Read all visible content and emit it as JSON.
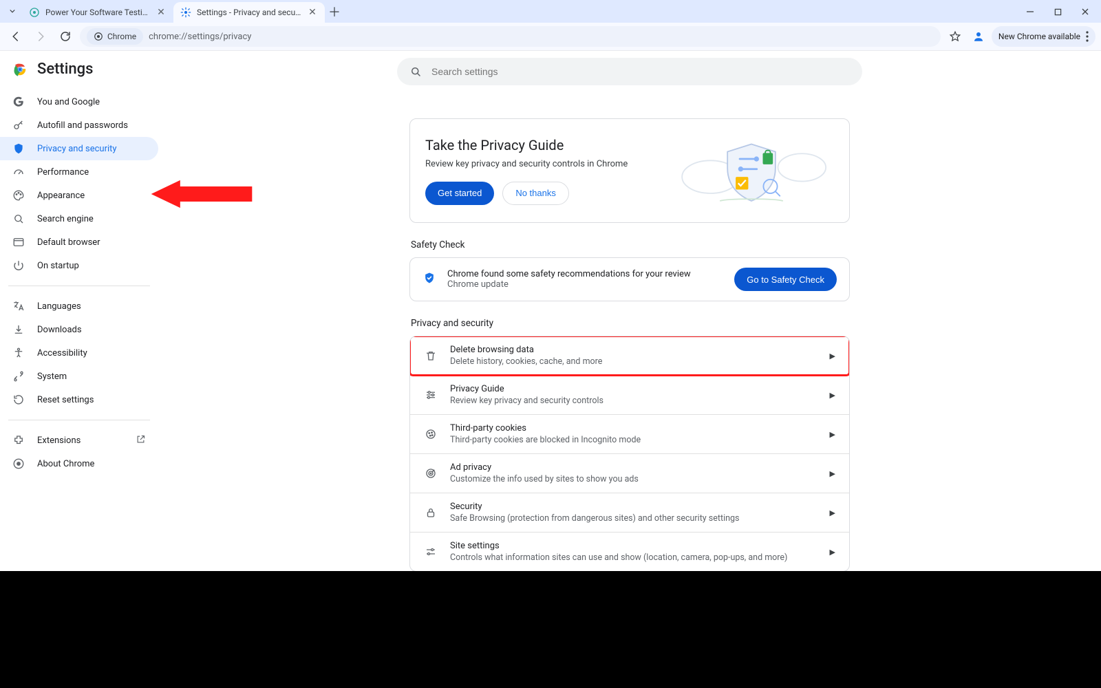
{
  "tabs": [
    {
      "title": "Power Your Software Testing wi",
      "favicon": "app"
    },
    {
      "title": "Settings - Privacy and security",
      "favicon": "gear",
      "active": true
    }
  ],
  "toolbar": {
    "chip_label": "Chrome",
    "url": "chrome://settings/privacy",
    "update_label": "New Chrome available"
  },
  "settings_title": "Settings",
  "search": {
    "placeholder": "Search settings"
  },
  "nav": {
    "groups": [
      [
        "You and Google",
        "Autofill and passwords",
        "Privacy and security",
        "Performance",
        "Appearance",
        "Search engine",
        "Default browser",
        "On startup"
      ],
      [
        "Languages",
        "Downloads",
        "Accessibility",
        "System",
        "Reset settings"
      ],
      [
        "Extensions",
        "About Chrome"
      ]
    ],
    "active_index": 2,
    "extlink_index": 0
  },
  "guide": {
    "title": "Take the Privacy Guide",
    "subtitle": "Review key privacy and security controls in Chrome",
    "primary": "Get started",
    "secondary": "No thanks"
  },
  "safety": {
    "heading": "Safety Check",
    "line1": "Chrome found some safety recommendations for your review",
    "line2": "Chrome update",
    "button": "Go to Safety Check"
  },
  "privacy_heading": "Privacy and security",
  "rows": [
    {
      "title": "Delete browsing data",
      "sub": "Delete history, cookies, cache, and more",
      "icon": "trash",
      "highlight": true
    },
    {
      "title": "Privacy Guide",
      "sub": "Review key privacy and security controls",
      "icon": "sliders"
    },
    {
      "title": "Third-party cookies",
      "sub": "Third-party cookies are blocked in Incognito mode",
      "icon": "cookie"
    },
    {
      "title": "Ad privacy",
      "sub": "Customize the info used by sites to show you ads",
      "icon": "ads"
    },
    {
      "title": "Security",
      "sub": "Safe Browsing (protection from dangerous sites) and other security settings",
      "icon": "lock"
    },
    {
      "title": "Site settings",
      "sub": "Controls what information sites can use and show (location, camera, pop-ups, and more)",
      "icon": "tune"
    }
  ]
}
